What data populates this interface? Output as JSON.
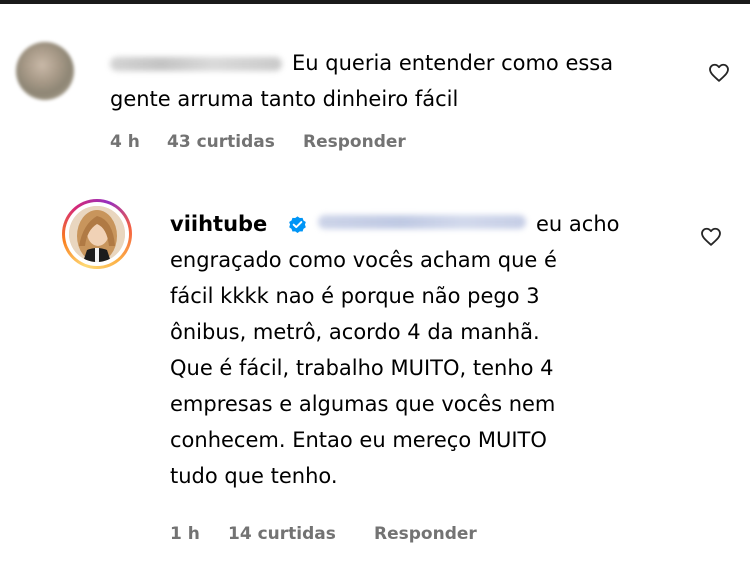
{
  "comments": [
    {
      "username": "",
      "text_lines": [
        "Eu queria entender como essa",
        "gente arruma tanto dinheiro fácil"
      ],
      "time": "4 h",
      "likes": "43 curtidas",
      "reply_label": "Responder",
      "liked": false
    },
    {
      "username": "viihtube",
      "verified": true,
      "text_lines": [
        "eu acho",
        "engraçado como vocês acham que é",
        "fácil kkkk nao é porque não pego 3",
        "ônibus, metrô, acordo 4 da manhã.",
        "Que é fácil, trabalho MUITO, tenho 4",
        "empresas e algumas que vocês nem",
        "conhecem. Entao eu mereço MUITO",
        "tudo que tenho."
      ],
      "time": "1 h",
      "likes": "14 curtidas",
      "reply_label": "Responder",
      "liked": false
    }
  ],
  "icons": {
    "like": "heart-outline-icon",
    "verified": "verified-badge-icon"
  },
  "colors": {
    "meta_text": "#737373",
    "verified_blue": "#0095f6",
    "text": "#000000"
  }
}
